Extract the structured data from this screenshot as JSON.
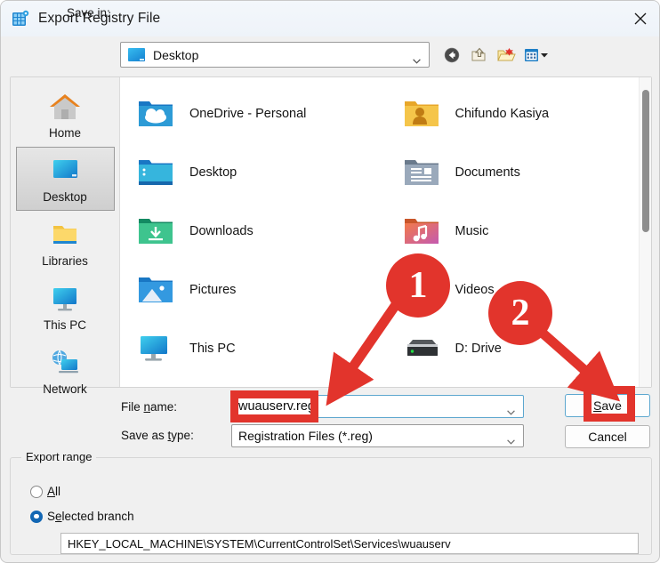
{
  "window": {
    "title": "Export Registry File",
    "icon": "registry-editor-icon",
    "close_label": "Close"
  },
  "savein": {
    "label": "Save in:",
    "accel": "i",
    "value": "Desktop",
    "icon": "desktop-monitor-icon"
  },
  "toolbar": {
    "items": [
      {
        "name": "back-icon",
        "tooltip": "Back"
      },
      {
        "name": "up-one-level-icon",
        "tooltip": "Up One Level"
      },
      {
        "name": "new-folder-icon",
        "tooltip": "Create New Folder"
      },
      {
        "name": "views-icon",
        "tooltip": "Views"
      }
    ]
  },
  "places": [
    {
      "label": "Home",
      "icon": "home-icon",
      "selected": false
    },
    {
      "label": "Desktop",
      "icon": "desktop-icon",
      "selected": true
    },
    {
      "label": "Libraries",
      "icon": "libraries-folder-icon",
      "selected": false
    },
    {
      "label": "This PC",
      "icon": "this-pc-icon",
      "selected": false
    },
    {
      "label": "Network",
      "icon": "network-icon",
      "selected": false
    }
  ],
  "files": [
    {
      "label": "OneDrive - Personal",
      "icon": "onedrive-folder-icon"
    },
    {
      "label": "Chifundo Kasiya",
      "icon": "user-folder-icon"
    },
    {
      "label": "Desktop",
      "icon": "desktop-folder-icon"
    },
    {
      "label": "Documents",
      "icon": "documents-folder-icon"
    },
    {
      "label": "Downloads",
      "icon": "downloads-folder-icon"
    },
    {
      "label": "Music",
      "icon": "music-folder-icon"
    },
    {
      "label": "Pictures",
      "icon": "pictures-folder-icon"
    },
    {
      "label": "Videos",
      "icon": "videos-folder-icon"
    },
    {
      "label": "This PC",
      "icon": "this-pc-icon"
    },
    {
      "label": "D: Drive",
      "icon": "hard-drive-icon"
    }
  ],
  "form": {
    "filename_label": "File name:",
    "filename_accel": "n",
    "filename_value": "wuauserv.reg",
    "savetype_label": "Save as type:",
    "savetype_accel": "t",
    "savetype_value": "Registration Files (*.reg)",
    "save_button": "Save",
    "save_accel": "S",
    "cancel_button": "Cancel"
  },
  "export_range": {
    "legend": "Export range",
    "options": [
      {
        "label": "All",
        "accel": "A",
        "selected": false
      },
      {
        "label": "Selected branch",
        "accel": "e",
        "selected": true
      }
    ],
    "branch_path": "HKEY_LOCAL_MACHINE\\SYSTEM\\CurrentControlSet\\Services\\wuauserv"
  },
  "annotations": {
    "badges": [
      {
        "text": "1",
        "target": "file-name-field"
      },
      {
        "text": "2",
        "target": "save-button"
      }
    ],
    "accent_color": "#e2342c"
  }
}
